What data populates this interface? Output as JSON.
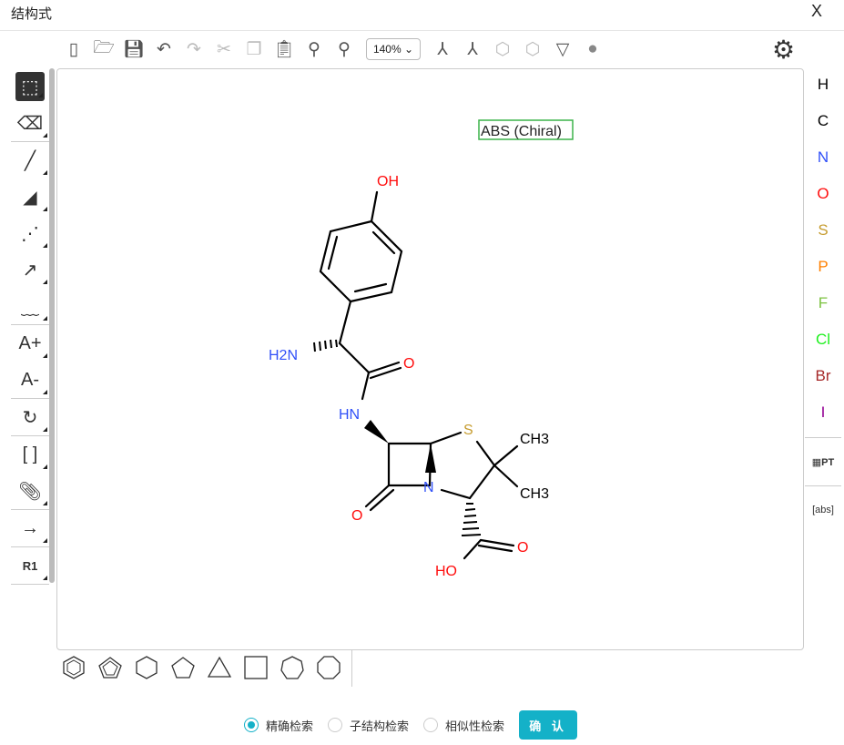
{
  "dialog": {
    "title": "结构式",
    "close": "X"
  },
  "toolbar": {
    "zoom": "140%",
    "icons": [
      "new-icon",
      "open-icon",
      "save-icon",
      "undo-icon",
      "redo-icon",
      "cut-icon",
      "copy-icon",
      "paste-icon",
      "zoom-in-icon",
      "zoom-out-icon",
      "layout-icon",
      "clean-icon",
      "aromatize-icon",
      "dearomatize-icon",
      "stereo-icon",
      "check-icon"
    ]
  },
  "left_tools": [
    "select",
    "erase",
    "single-bond",
    "wedge-bond",
    "hash-bond",
    "arrow-bond",
    "wavy-bond",
    "charge-plus",
    "charge-minus",
    "rotate",
    "brackets",
    "attachment",
    "reaction-arrow",
    "rgroup"
  ],
  "left_labels": {
    "charge_plus": "A+",
    "charge_minus": "A-",
    "brackets": "[ ]",
    "rgroup": "R1"
  },
  "elements": [
    {
      "symbol": "H",
      "color": "#000000"
    },
    {
      "symbol": "C",
      "color": "#000000"
    },
    {
      "symbol": "N",
      "color": "#3050F8"
    },
    {
      "symbol": "O",
      "color": "#FF0D0D"
    },
    {
      "symbol": "S",
      "color": "#C69C2F"
    },
    {
      "symbol": "P",
      "color": "#FF8000"
    },
    {
      "symbol": "F",
      "color": "#7CC240"
    },
    {
      "symbol": "Cl",
      "color": "#1FF01F"
    },
    {
      "symbol": "Br",
      "color": "#A62929"
    },
    {
      "symbol": "I",
      "color": "#940094"
    }
  ],
  "right_extra": {
    "periodic": "PT",
    "abs": "[abs]"
  },
  "molecule": {
    "chiral_label": "ABS (Chiral)",
    "atoms": {
      "oh_top": "OH",
      "nh2": "H2N",
      "o_amide": "O",
      "hn": "HN",
      "s": "S",
      "ch3_a": "CH3",
      "ch3_b": "CH3",
      "n": "N",
      "o_lactam": "O",
      "o_acid": "O",
      "ho": "HO"
    }
  },
  "search": {
    "options": [
      "精确检索",
      "子结构检索",
      "相似性检索"
    ],
    "selected": 0,
    "confirm": "确 认"
  }
}
